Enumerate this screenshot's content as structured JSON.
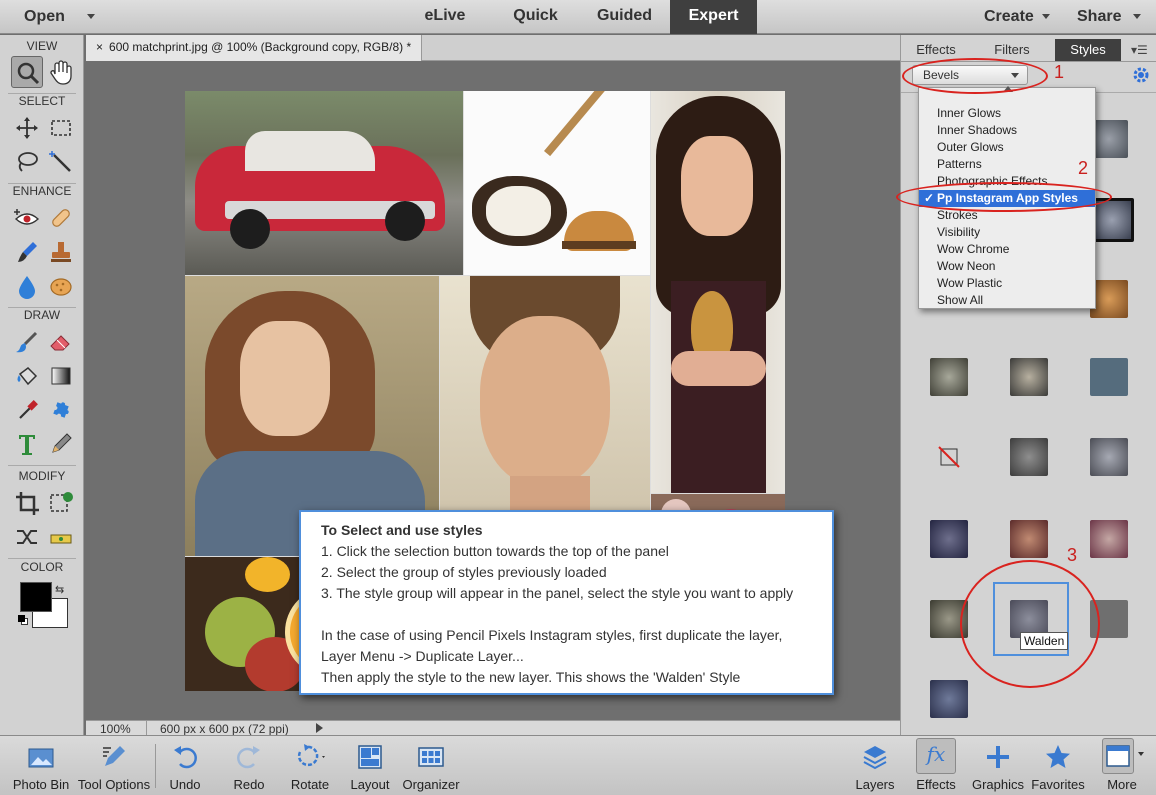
{
  "topbar": {
    "open_label": "Open",
    "modes": [
      "eLive",
      "Quick",
      "Guided",
      "Expert"
    ],
    "create_label": "Create",
    "share_label": "Share"
  },
  "toolbar": {
    "sections": [
      "VIEW",
      "SELECT",
      "ENHANCE",
      "DRAW",
      "MODIFY",
      "COLOR"
    ]
  },
  "document": {
    "tab_close": "×",
    "tab_title": "600 matchprint.jpg @ 100% (Background copy, RGB/8) *",
    "zoom": "100%",
    "size_info": "600 px x 600 px (72 ppi)"
  },
  "infobox": {
    "title": "To Select and use styles",
    "lines": [
      "1. Click the selection button towards the top of the panel",
      "2. Select the group of styles previously loaded",
      "3. The style group will appear in the panel, select the style you want to apply",
      "",
      "In the case of using Pencil Pixels Instagram styles, first duplicate the layer,",
      "Layer Menu -> Duplicate Layer...",
      "Then apply the style to the new layer. This shows the 'Walden' Style"
    ]
  },
  "panel": {
    "tabs": [
      "Effects",
      "Filters",
      "Styles"
    ],
    "active_tab": "Styles",
    "dropdown_value": "Bevels",
    "menu_items": [
      "Inner Glows",
      "Inner Shadows",
      "Outer Glows",
      "Patterns",
      "Photographic Effects",
      "Pp Instagram App Styles",
      "Strokes",
      "Visibility",
      "Wow Chrome",
      "Wow Neon",
      "Wow Plastic",
      "Show All"
    ],
    "checked_item": "Pp Instagram App Styles",
    "tooltip": "Walden"
  },
  "annotations": {
    "n1": "1",
    "n2": "2",
    "n3": "3"
  },
  "bottombar": {
    "items": [
      "Photo Bin",
      "Tool Options",
      "Undo",
      "Redo",
      "Rotate",
      "Layout",
      "Organizer"
    ],
    "right_items": [
      "Layers",
      "Effects",
      "Graphics",
      "Favorites",
      "More"
    ]
  },
  "colors": {
    "accent": "#2f6fd8",
    "annotation_red": "#d9231f",
    "expert_tab": "#3f3f3f"
  }
}
